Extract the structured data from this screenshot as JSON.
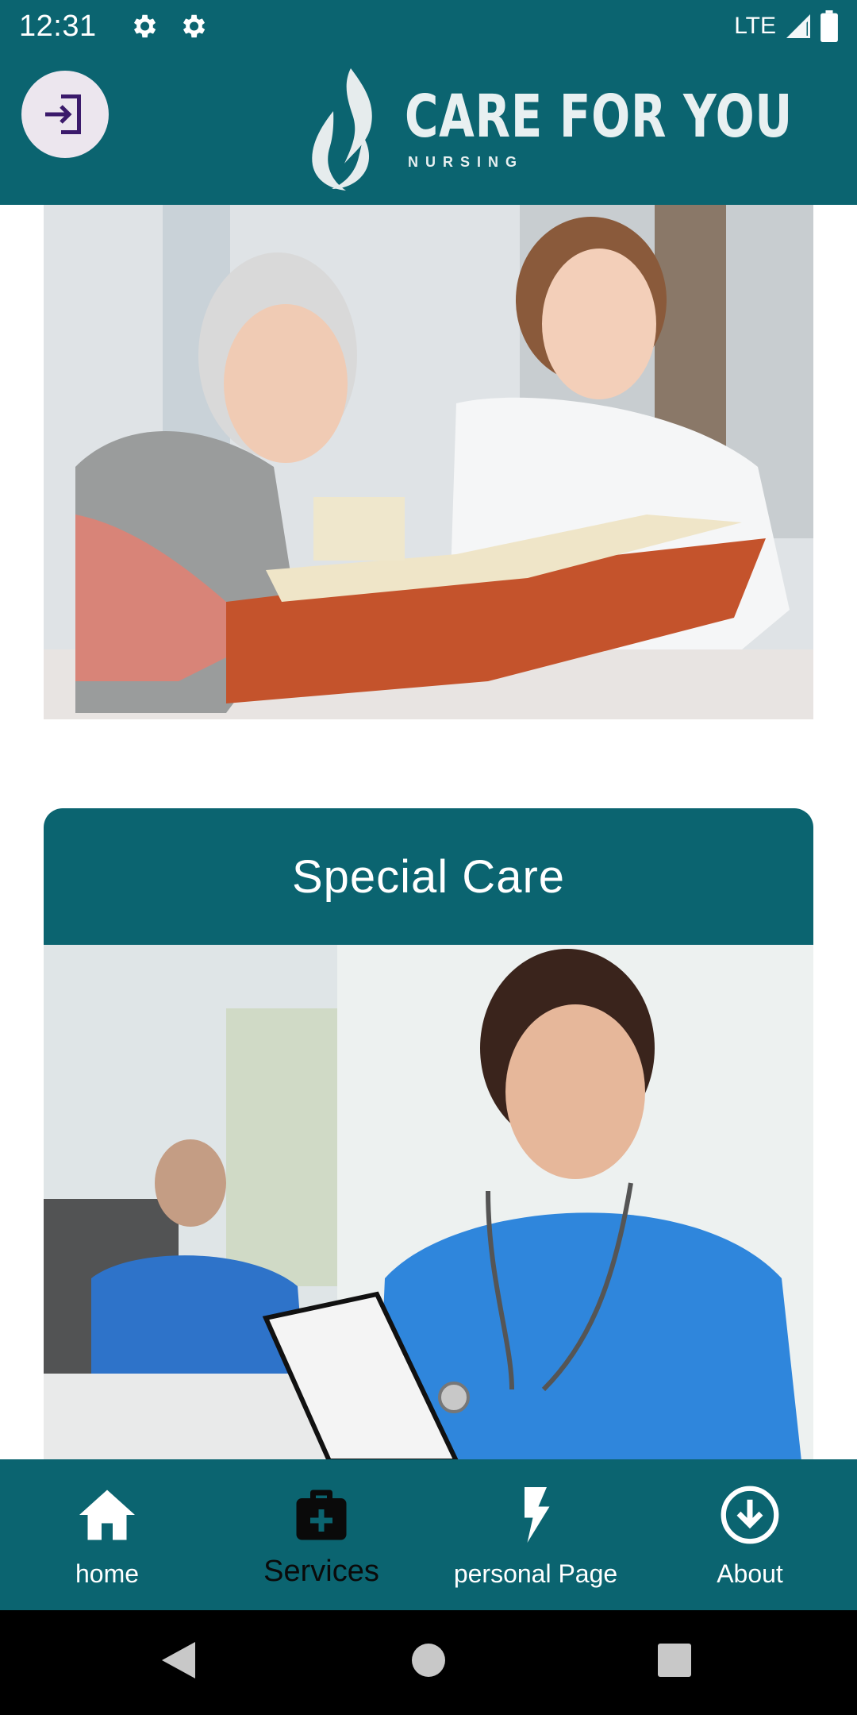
{
  "status_bar": {
    "time": "12:31",
    "network": "LTE",
    "icons": [
      "gear-icon",
      "gear-icon",
      "signal-icon",
      "battery-icon"
    ]
  },
  "app_bar": {
    "logo_title": "CARE FOR YOU",
    "logo_subtitle": "NURSING",
    "login_icon": "login-icon",
    "background": "#0b6470"
  },
  "content": {
    "card_title": "Special Care"
  },
  "bottom_nav": {
    "items": [
      {
        "label": "home",
        "icon": "home-icon"
      },
      {
        "label": "Services",
        "icon": "medical-bag-icon",
        "active": true
      },
      {
        "label": "personal Page",
        "icon": "lightning-icon"
      },
      {
        "label": "About",
        "icon": "download-circle-icon"
      }
    ]
  },
  "colors": {
    "primary": "#0b6470",
    "login_button": "#ece6ee",
    "login_icon": "#3b1a6b"
  }
}
